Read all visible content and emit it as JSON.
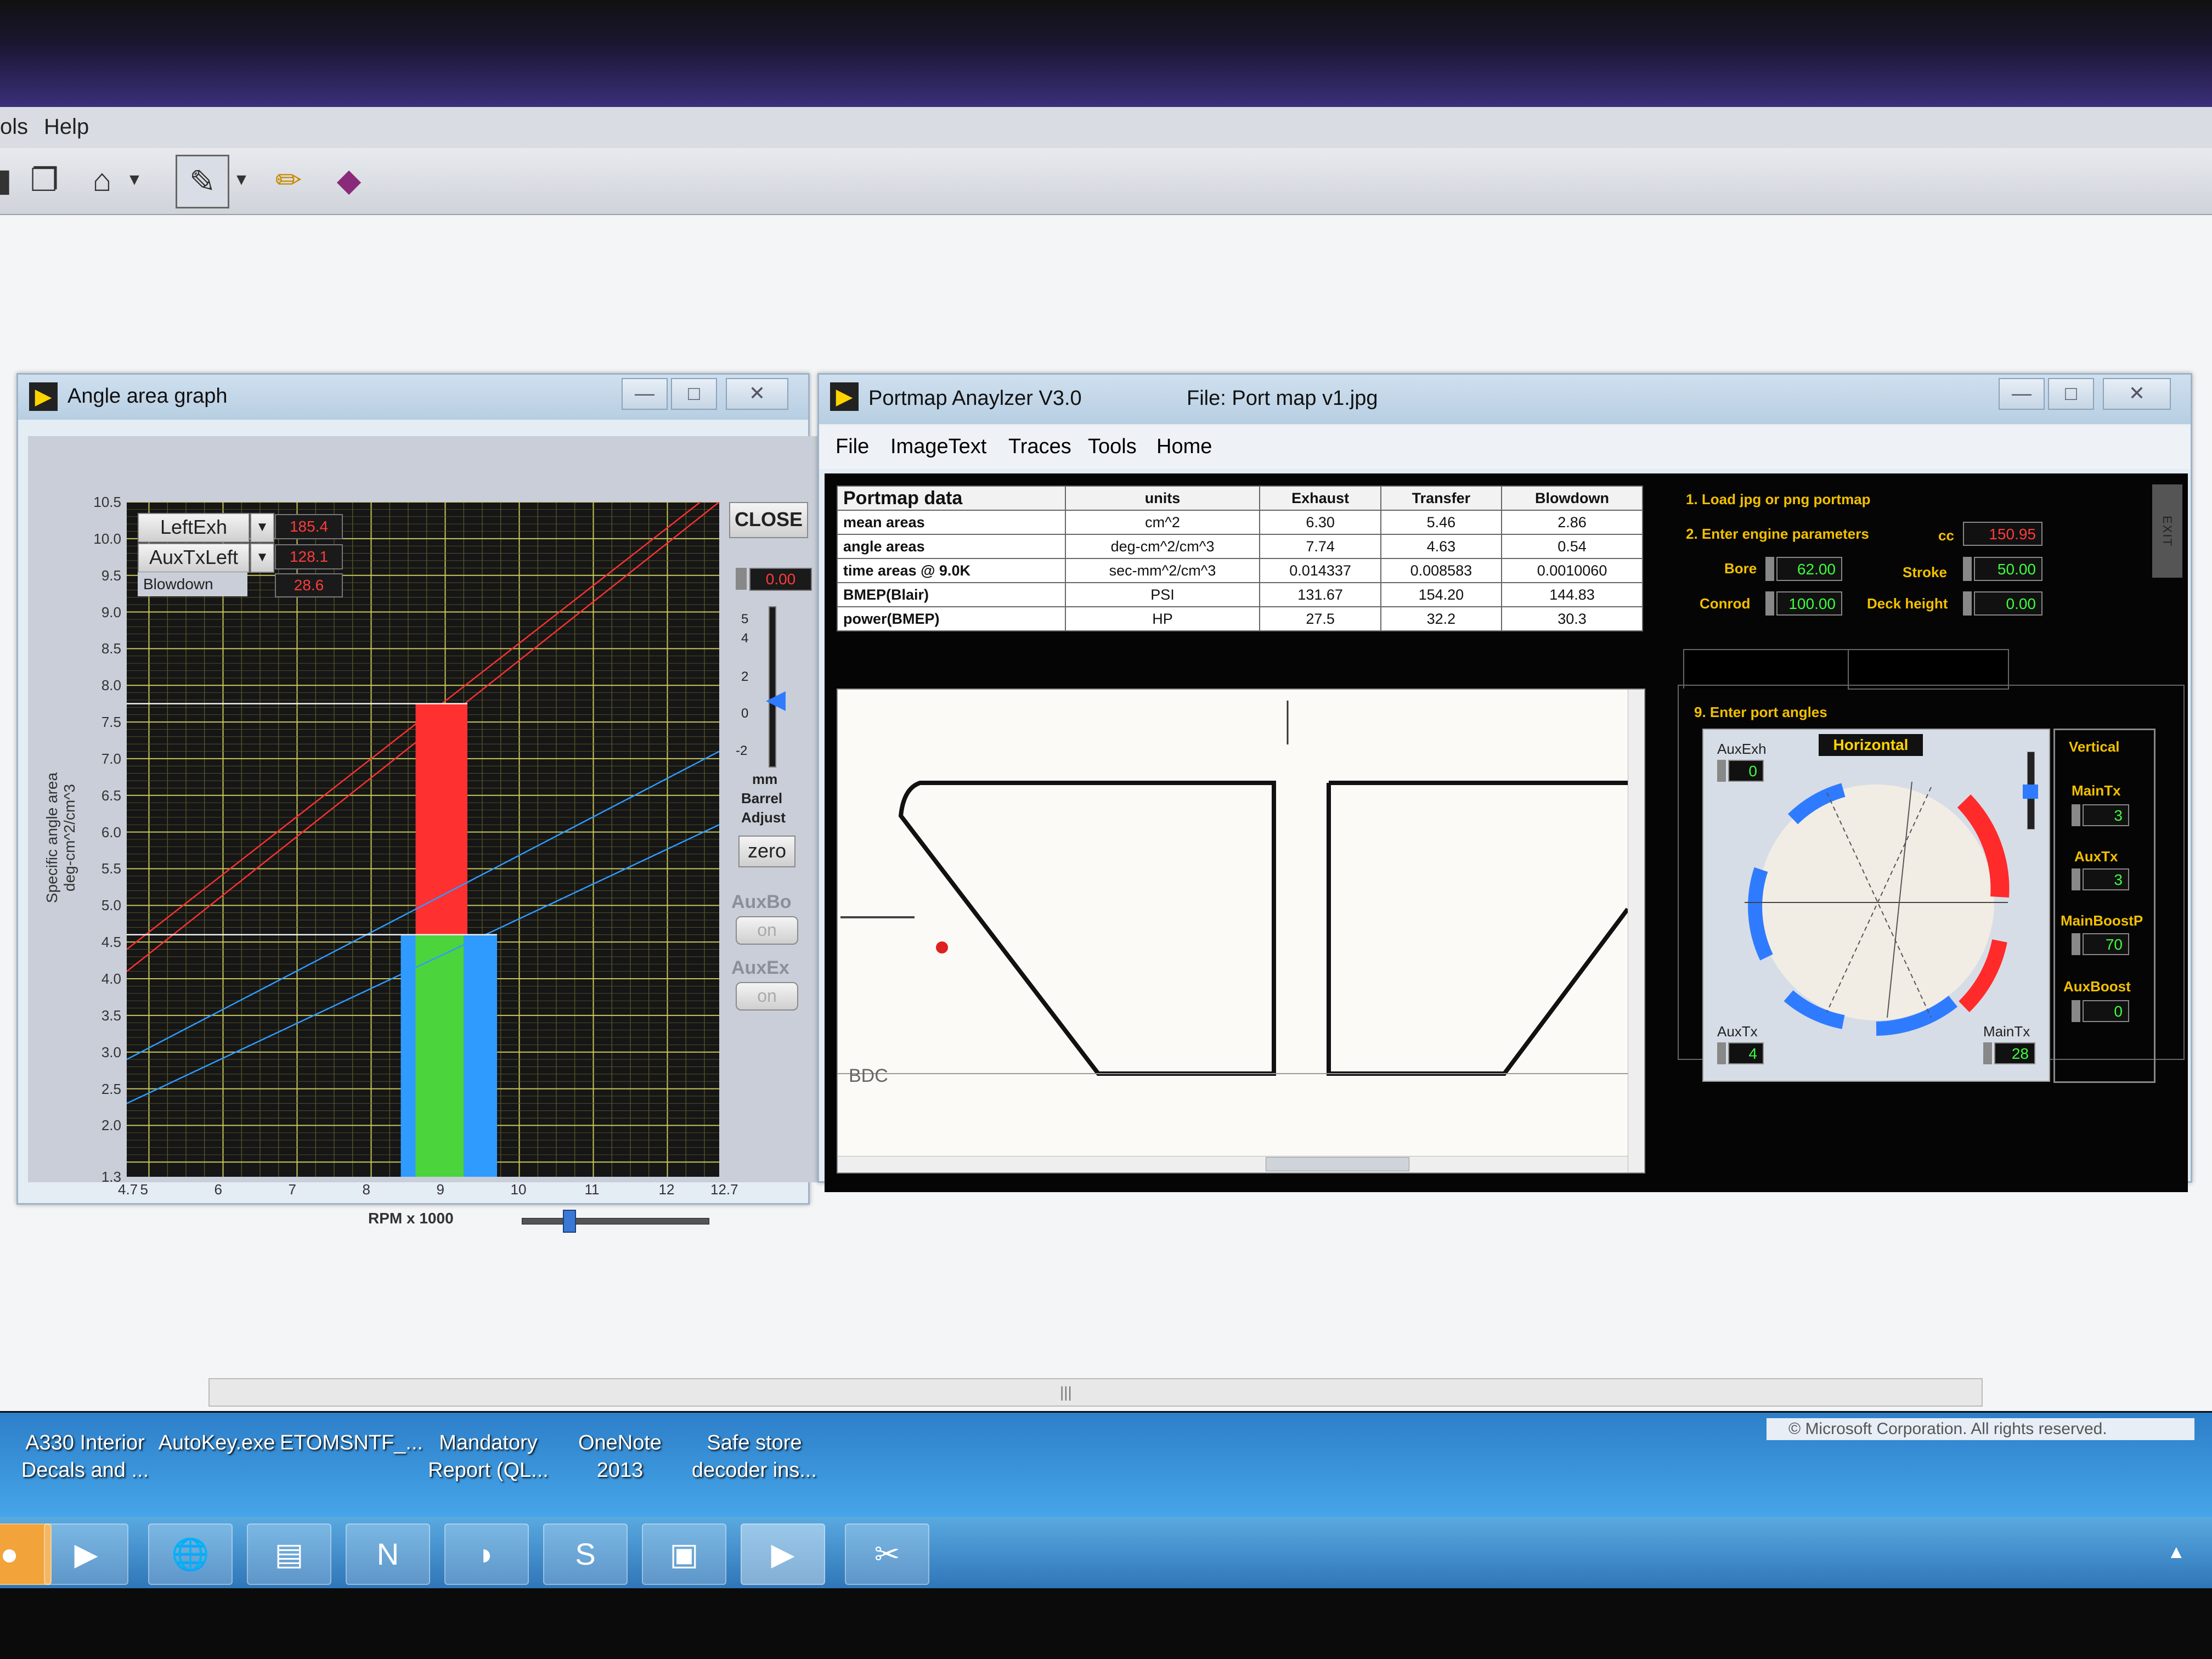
{
  "menubar": {
    "items": [
      "ols",
      "Help"
    ]
  },
  "toolbar": {
    "icons": [
      "paste-icon",
      "copy-icon",
      "scan-icon",
      "dropdown-arrow-icon",
      "pen-icon",
      "pen-dropdown-icon",
      "pencil-icon",
      "eraser-icon"
    ]
  },
  "angle_window": {
    "title": "Angle area graph",
    "close_label": "CLOSE",
    "legend": [
      {
        "label": "LeftExh",
        "value": "185.4"
      },
      {
        "label": "AuxTxLeft",
        "value": "128.1"
      },
      {
        "label": "Blowdown",
        "value": "28.6"
      }
    ],
    "barrel": {
      "value": "0.00",
      "ticks": [
        "5",
        "4",
        "2",
        "0",
        "-2"
      ],
      "caption1": "mm",
      "caption2": "Barrel",
      "caption3": "Adjust",
      "zero_label": "zero"
    },
    "aux_bo": {
      "label": "AuxBo",
      "state": "on"
    },
    "aux_ex": {
      "label": "AuxEx",
      "state": "on"
    },
    "colors": {
      "exhaust": "#ff3030",
      "transfer": "#2f9bff",
      "blowdown": "#4cd43c"
    }
  },
  "chart_data": {
    "type": "bar",
    "ylabel": "Specific angle area deg-cm^2/cm^3",
    "xlabel": "RPM x 1000",
    "xlim": [
      4.7,
      12.7
    ],
    "ylim": [
      1.3,
      10.5
    ],
    "x_ticks": [
      "4.7",
      "5",
      "6",
      "7",
      "8",
      "9",
      "10",
      "11",
      "12",
      "12.7"
    ],
    "y_ticks": [
      "10.5",
      "10.0",
      "9.5",
      "9.0",
      "8.5",
      "8.0",
      "7.5",
      "7.0",
      "6.5",
      "6.0",
      "5.5",
      "5.0",
      "4.5",
      "4.0",
      "3.5",
      "3.0",
      "2.5",
      "2.0",
      "1.3"
    ],
    "bars": [
      {
        "name": "transfer",
        "x0": 8.4,
        "x1": 8.85,
        "y0": 1.3,
        "y1": 4.6
      },
      {
        "name": "blowdown",
        "x0": 8.6,
        "x1": 9.25,
        "y0": 1.3,
        "y1": 4.6
      },
      {
        "name": "transfer",
        "x0": 9.25,
        "x1": 9.7,
        "y0": 1.3,
        "y1": 4.6
      },
      {
        "name": "exhaust",
        "x0": 8.6,
        "x1": 9.3,
        "y0": 4.6,
        "y1": 7.75
      }
    ],
    "lines": [
      {
        "name": "exhaust",
        "points": [
          [
            4.7,
            4.1
          ],
          [
            12.7,
            10.5
          ]
        ]
      },
      {
        "name": "exhaust",
        "points": [
          [
            4.7,
            4.4
          ],
          [
            12.7,
            10.7
          ]
        ]
      },
      {
        "name": "transfer",
        "points": [
          [
            4.7,
            2.3
          ],
          [
            12.7,
            6.1
          ]
        ]
      },
      {
        "name": "transfer",
        "points": [
          [
            4.7,
            2.9
          ],
          [
            12.7,
            7.1
          ]
        ]
      },
      {
        "name": "reference",
        "points": [
          [
            4.7,
            7.75
          ],
          [
            9.3,
            7.75
          ]
        ]
      },
      {
        "name": "reference",
        "points": [
          [
            4.7,
            4.6
          ],
          [
            9.7,
            4.6
          ]
        ]
      }
    ]
  },
  "portmap_window": {
    "title": "Portmap Anaylzer V3.0",
    "file_label": "File: Port map v1.jpg",
    "menu": [
      "File",
      "ImageText",
      "Traces",
      "Tools",
      "Home"
    ],
    "table": {
      "headers": [
        "Portmap data",
        "units",
        "Exhaust",
        "Transfer",
        "Blowdown"
      ],
      "rows": [
        [
          "mean areas",
          "cm^2",
          "6.30",
          "5.46",
          "2.86"
        ],
        [
          "angle areas",
          "deg-cm^2/cm^3",
          "7.74",
          "4.63",
          "0.54"
        ],
        [
          "time areas @ 9.0K",
          "sec-mm^2/cm^3",
          "0.014337",
          "0.008583",
          "0.0010060"
        ],
        [
          "BMEP(Blair)",
          "PSI",
          "131.67",
          "154.20",
          "144.83"
        ],
        [
          "power(BMEP)",
          "HP",
          "27.5",
          "32.2",
          "30.3"
        ]
      ]
    },
    "image_label": "BDC",
    "steps": {
      "step1": "1. Load jpg or png portmap",
      "step2": "2. Enter engine parameters",
      "step9": "9. Enter port angles"
    },
    "params": {
      "cc_label": "cc",
      "cc": "150.95",
      "bore_label": "Bore",
      "bore": "62.00",
      "stroke_label": "Stroke",
      "stroke": "50.00",
      "conrod_label": "Conrod",
      "conrod": "100.00",
      "deck_label": "Deck height",
      "deck": "0.00"
    },
    "exit_label": "EXIT",
    "angles": {
      "horizontal_label": "Horizontal",
      "vertical_label": "Vertical",
      "auxexh_label": "AuxExh",
      "auxexh": "0",
      "auxtx_label": "AuxTx",
      "auxtx": "4",
      "maintx_label": "MainTx",
      "maintx": "28",
      "v_maintx_label": "MainTx",
      "v_maintx": "3",
      "v_auxtx_label": "AuxTx",
      "v_auxtx": "3",
      "v_mainboost_label": "MainBoostP",
      "v_mainboost": "70",
      "v_auxboost_label": "AuxBoost",
      "v_auxboost": "0"
    }
  },
  "desktop": {
    "icons": [
      {
        "line1": "A330 Interior",
        "line2": "Decals and ..."
      },
      {
        "line1": "AutoKey.exe",
        "line2": ""
      },
      {
        "line1": "ETOMSNTF_...",
        "line2": ""
      },
      {
        "line1": "Mandatory",
        "line2": "Report (QL..."
      },
      {
        "line1": "OneNote",
        "line2": "2013"
      },
      {
        "line1": "Safe store",
        "line2": "decoder ins..."
      }
    ],
    "copyright": "© Microsoft Corporation. All rights reserved."
  },
  "taskbar": {
    "items": [
      "media-player-icon",
      "network-icon",
      "file-explorer-icon",
      "onenote-icon",
      "app-icon",
      "skype-icon",
      "window-icon",
      "labview-icon",
      "snipping-tool-icon"
    ],
    "tray_arrow": "▲"
  }
}
